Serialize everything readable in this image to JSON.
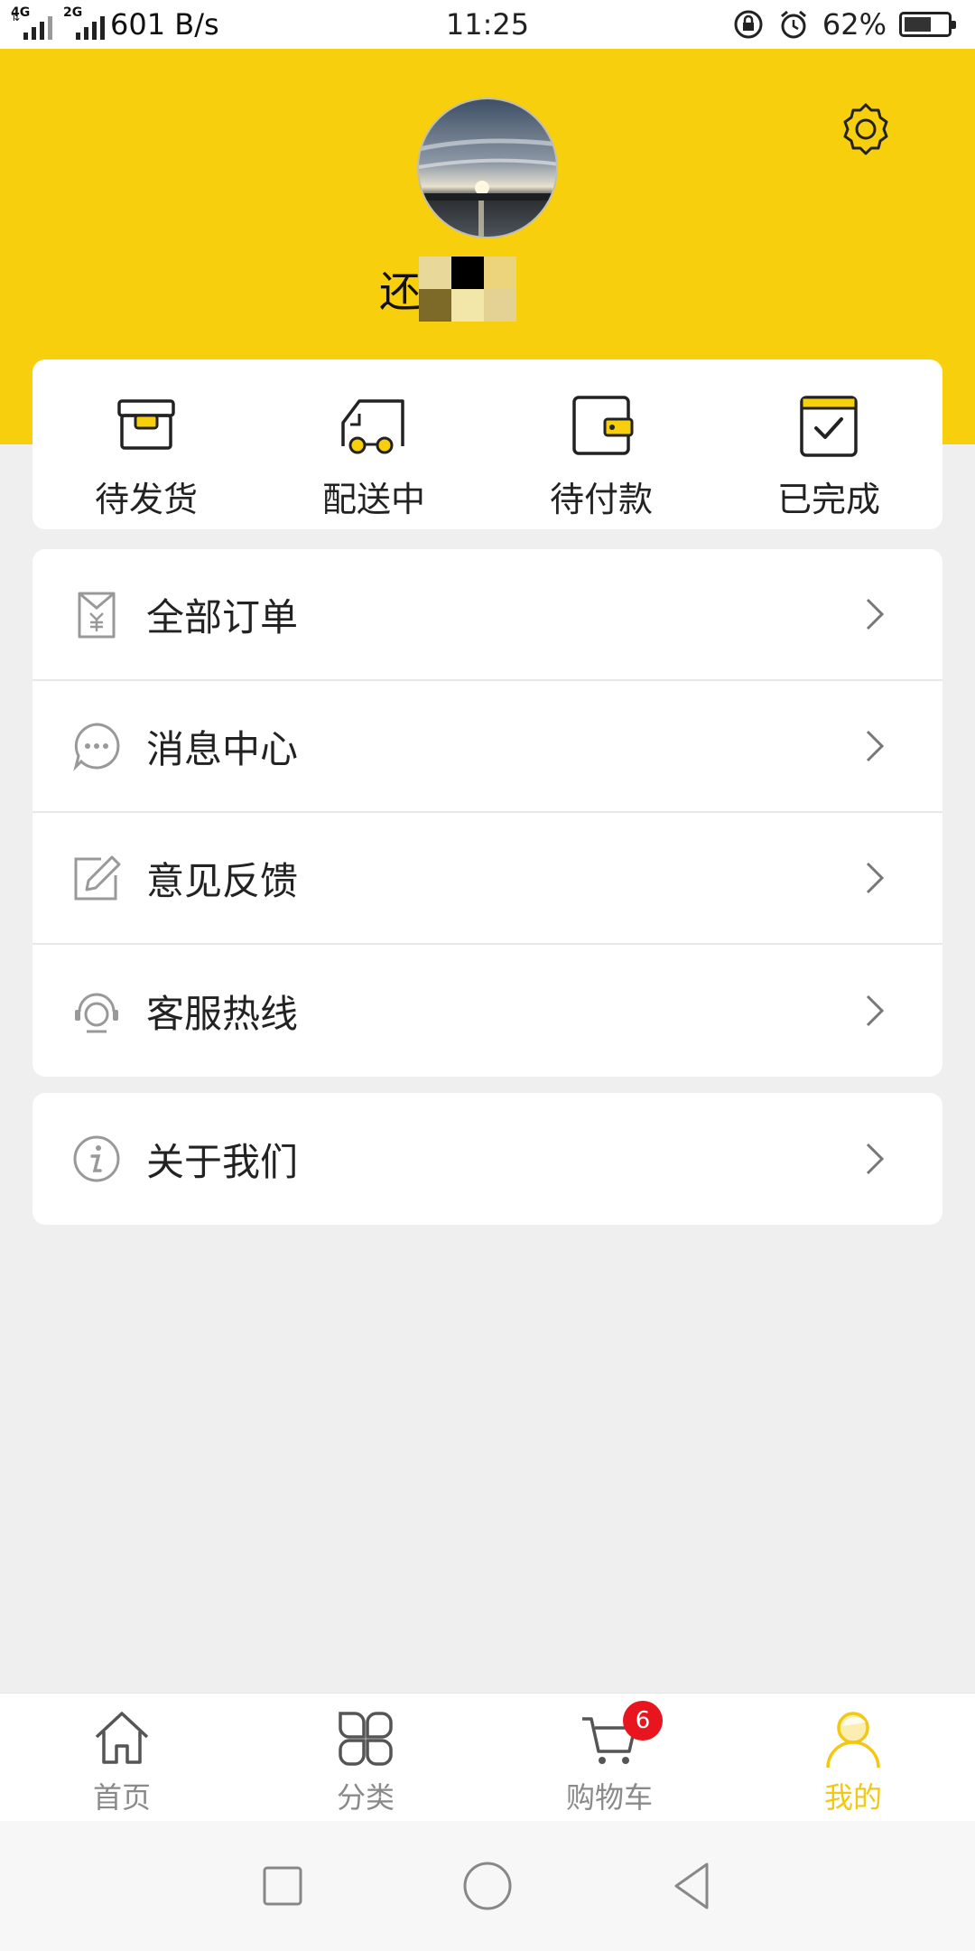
{
  "status_bar": {
    "net1": "4G",
    "net2": "2G",
    "speed": "601 B/s",
    "time": "11:25",
    "battery_text": "62%",
    "battery_level": 0.62
  },
  "header": {
    "background": "#f8cf0c",
    "username": "还"
  },
  "orders": [
    {
      "label": "待发货",
      "icon": "box-icon"
    },
    {
      "label": "配送中",
      "icon": "delivery-truck-icon"
    },
    {
      "label": "待付款",
      "icon": "wallet-icon"
    },
    {
      "label": "已完成",
      "icon": "calendar-check-icon"
    }
  ],
  "menu": [
    {
      "label": "全部订单",
      "icon": "yen-receipt-icon"
    },
    {
      "label": "消息中心",
      "icon": "chat-bubble-icon"
    },
    {
      "label": "意见反馈",
      "icon": "edit-pencil-icon"
    },
    {
      "label": "客服热线",
      "icon": "headset-icon"
    }
  ],
  "menu2": [
    {
      "label": "关于我们",
      "icon": "info-icon"
    }
  ],
  "tabs": [
    {
      "label": "首页",
      "icon": "home-icon"
    },
    {
      "label": "分类",
      "icon": "category-grid-icon"
    },
    {
      "label": "购物车",
      "icon": "cart-icon",
      "badge": "6"
    },
    {
      "label": "我的",
      "icon": "profile-icon",
      "active": true
    }
  ],
  "colors": {
    "accent": "#f8cf0c",
    "badge": "#e8141e",
    "active_tab": "#f2c811"
  }
}
